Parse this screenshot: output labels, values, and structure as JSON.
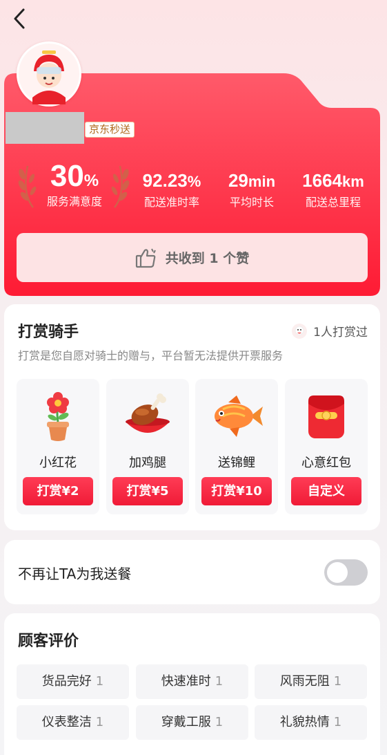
{
  "nav": {
    "back_icon": "chevron-left-icon"
  },
  "rider": {
    "avatar_icon": "rider-avatar",
    "brand_tag": "京东秒送",
    "stats": [
      {
        "value": "30",
        "unit": "%",
        "label": "服务满意度"
      },
      {
        "value": "92.23",
        "unit": "%",
        "label": "配送准时率"
      },
      {
        "value": "29",
        "unit": "min",
        "label": "平均时长"
      },
      {
        "value": "1664",
        "unit": "km",
        "label": "配送总里程"
      }
    ],
    "likes_text": "共收到 1 个赞"
  },
  "tip": {
    "title": "打赏骑手",
    "count_text": "1人打赏过",
    "note": "打赏是您自愿对骑士的赠与，平台暂无法提供开票服务",
    "gifts": [
      {
        "name": "小红花",
        "button": "打赏¥2",
        "icon": "flower-icon"
      },
      {
        "name": "加鸡腿",
        "button": "打赏¥5",
        "icon": "chicken-leg-icon"
      },
      {
        "name": "送锦鲤",
        "button": "打赏¥10",
        "icon": "koi-fish-icon"
      },
      {
        "name": "心意红包",
        "button": "自定义",
        "icon": "red-envelope-icon"
      }
    ]
  },
  "block": {
    "label": "不再让TA为我送餐",
    "enabled": false
  },
  "reviews": {
    "title": "顾客评价",
    "tags": [
      {
        "label": "货品完好",
        "count": "1"
      },
      {
        "label": "快速准时",
        "count": "1"
      },
      {
        "label": "风雨无阻",
        "count": "1"
      },
      {
        "label": "仪表整洁",
        "count": "1"
      },
      {
        "label": "穿戴工服",
        "count": "1"
      },
      {
        "label": "礼貌热情",
        "count": "1"
      }
    ]
  },
  "colors": {
    "accent": "#f01b37",
    "card_red": "#ff2d47"
  }
}
